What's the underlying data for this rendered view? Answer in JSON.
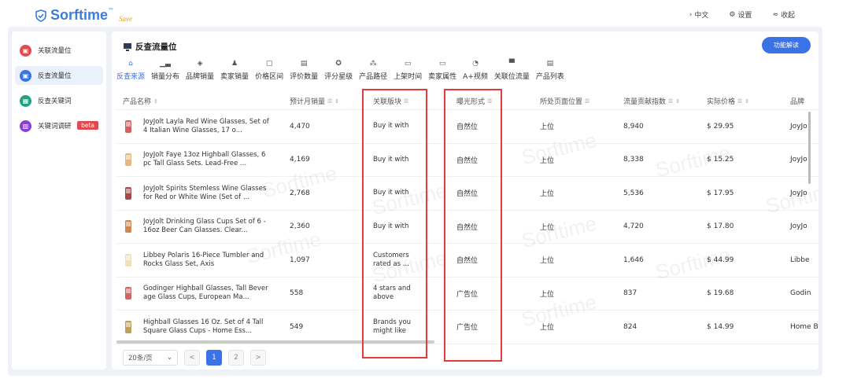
{
  "app": {
    "logo_text": "Sorftime",
    "logo_tm": "™",
    "logo_sub": "Save"
  },
  "topbar": {
    "lang": "中文",
    "settings": "设置",
    "collapse": "收起"
  },
  "sidebar": {
    "items": [
      {
        "label": "关联流量位",
        "color": "#e5484d",
        "active": false
      },
      {
        "label": "反查流量位",
        "color": "#3a72e8",
        "active": true
      },
      {
        "label": "反查关键词",
        "color": "#1fa383",
        "active": false
      },
      {
        "label": "关键词调研",
        "color": "#8a3fd9",
        "active": false,
        "badge": "beta"
      }
    ]
  },
  "main": {
    "title": "反查流量位",
    "func_button": "功能解读",
    "tabs": [
      {
        "label": "反查来源",
        "icon": "data-source-icon",
        "active": true
      },
      {
        "label": "销量分布",
        "icon": "bar-chart-icon"
      },
      {
        "label": "品牌销量",
        "icon": "shield-icon"
      },
      {
        "label": "卖家销量",
        "icon": "seller-icon"
      },
      {
        "label": "价格区间",
        "icon": "price-icon"
      },
      {
        "label": "评价数量",
        "icon": "review-icon"
      },
      {
        "label": "评分星级",
        "icon": "star-icon"
      },
      {
        "label": "产品路径",
        "icon": "tree-icon"
      },
      {
        "label": "上架时间",
        "icon": "calendar-icon"
      },
      {
        "label": "卖家属性",
        "icon": "store-icon"
      },
      {
        "label": "A+视频",
        "icon": "video-icon"
      },
      {
        "label": "关联位流量",
        "icon": "traffic-icon"
      },
      {
        "label": "产品列表",
        "icon": "list-icon"
      }
    ]
  },
  "table": {
    "headers": {
      "name": "产品名称",
      "sales": "预计月销量",
      "block": "关联版块",
      "form": "曝光形式",
      "pos": "所处页面位置",
      "traffic": "流量贡献指数",
      "price": "实际价格",
      "brand": "品牌"
    },
    "rows": [
      {
        "name": "JoyJolt Layla Red Wine Glasses, Set of 4 Italian Wine Glasses, 17 o...",
        "sales": "4,470",
        "block": "Buy it with",
        "form": "自然位",
        "pos": "上位",
        "traffic": "8,940",
        "price": "$ 29.95",
        "brand": "JoyJo"
      },
      {
        "name": "JoyJolt Faye 13oz Highball Glasses, 6pc Tall Glass Sets. Lead-Free ...",
        "sales": "4,169",
        "block": "Buy it with",
        "form": "自然位",
        "pos": "上位",
        "traffic": "8,338",
        "price": "$ 15.25",
        "brand": "JoyJo"
      },
      {
        "name": "JoyJolt Spirits Stemless Wine Glasses for Red or White Wine (Set of ...",
        "sales": "2,768",
        "block": "Buy it with",
        "form": "自然位",
        "pos": "上位",
        "traffic": "5,536",
        "price": "$ 17.95",
        "brand": "JoyJo"
      },
      {
        "name": "JoyJolt Drinking Glass Cups Set of 6 - 16oz Beer Can Glasses. Clear...",
        "sales": "2,360",
        "block": "Buy it with",
        "form": "自然位",
        "pos": "上位",
        "traffic": "4,720",
        "price": "$ 17.80",
        "brand": "JoyJo"
      },
      {
        "name": "Libbey Polaris 16-Piece Tumbler and Rocks Glass Set, Axis",
        "sales": "1,097",
        "block": "Customers rated as ...",
        "form": "自然位",
        "pos": "上位",
        "traffic": "1,646",
        "price": "$ 44.99",
        "brand": "Libbe"
      },
      {
        "name": "Godinger Highball Glasses, Tall Beverage Glass Cups, European Ma...",
        "sales": "558",
        "block": "4 stars and above",
        "form": "广告位",
        "pos": "上位",
        "traffic": "837",
        "price": "$ 19.68",
        "brand": "Godin"
      },
      {
        "name": "Highball Glasses 16 Oz. Set of 4 Tall Square Glass Cups - Home Ess...",
        "sales": "549",
        "block": "Brands you might like",
        "form": "广告位",
        "pos": "上位",
        "traffic": "824",
        "price": "$ 14.99",
        "brand": "Home Beyo"
      }
    ]
  },
  "pager": {
    "size": "20条/页",
    "prev": "<",
    "pages": [
      "1",
      "2"
    ],
    "next": ">"
  },
  "watermark": "Sorftime"
}
